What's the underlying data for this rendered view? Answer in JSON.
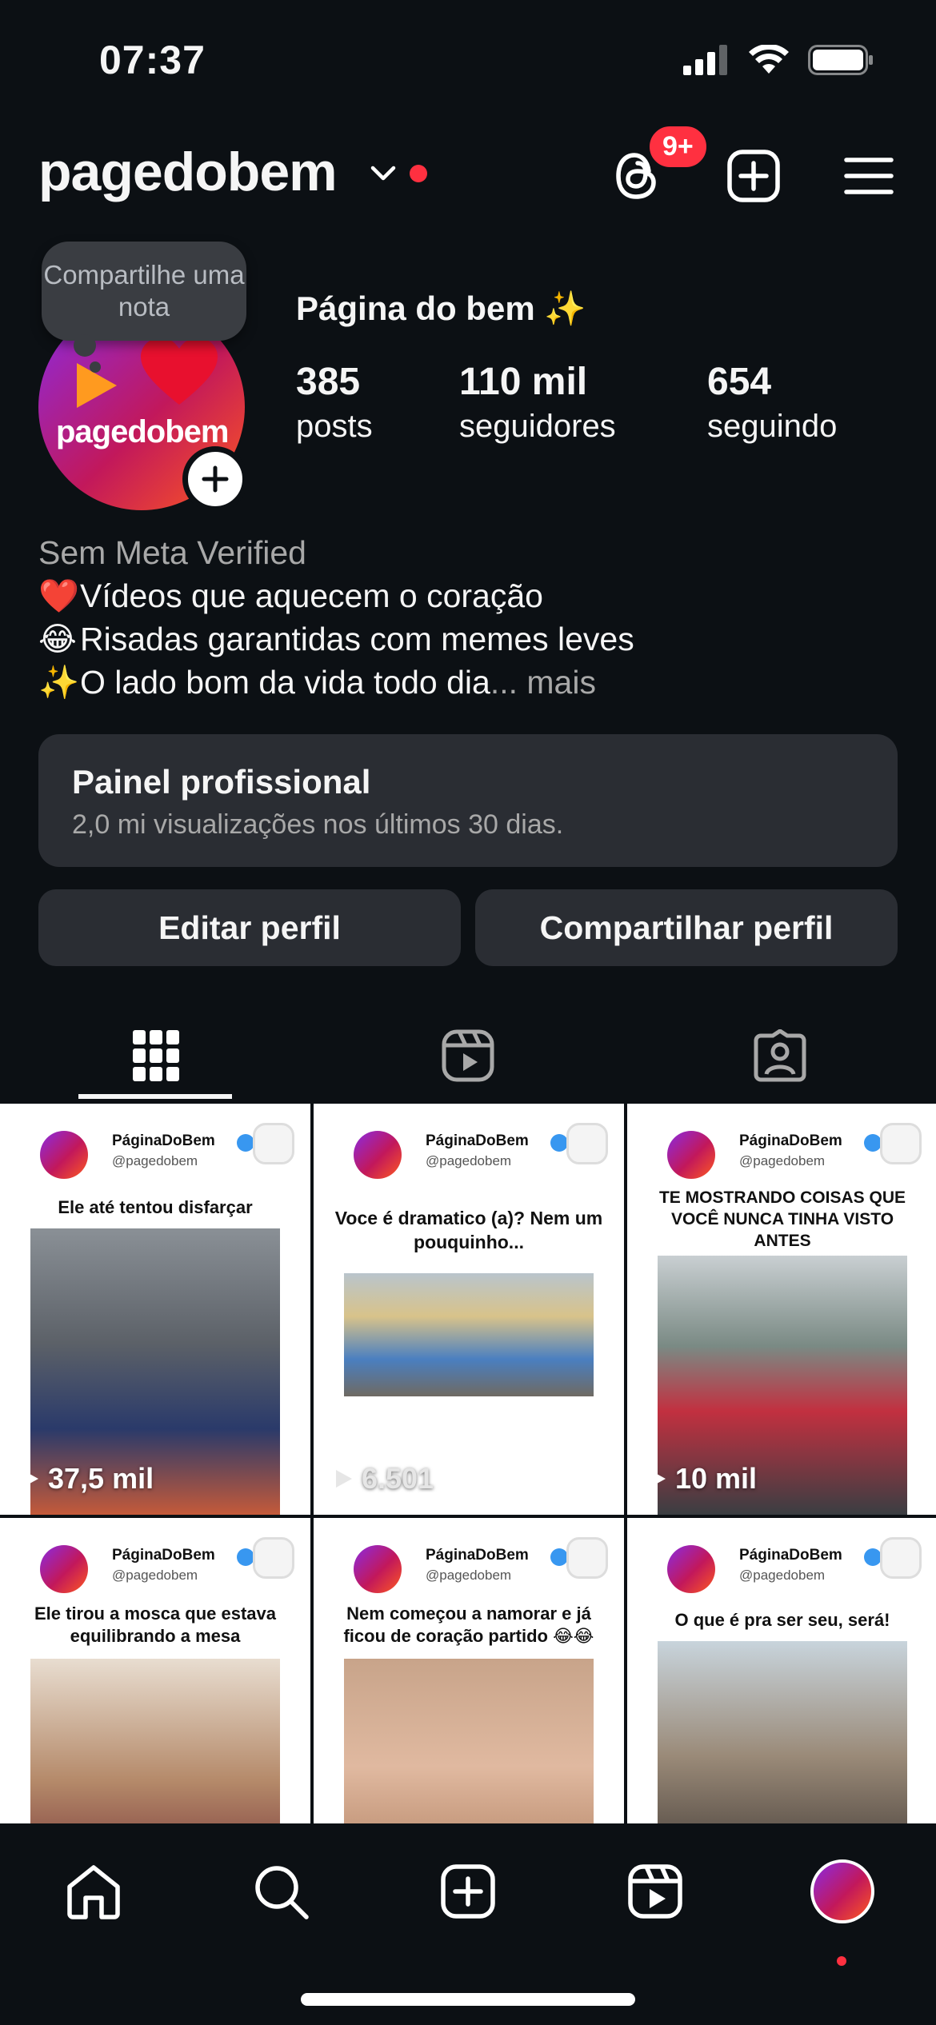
{
  "status_bar": {
    "time": "07:37"
  },
  "header": {
    "username": "pagedobem",
    "threads_badge": "9+"
  },
  "profile": {
    "note_text": "Compartilhe uma nota",
    "avatar_text": "pagedobem",
    "display_name": "Página do bem ✨",
    "stats": [
      {
        "number": "385",
        "label": "posts"
      },
      {
        "number": "110 mil",
        "label": "seguidores"
      },
      {
        "number": "654",
        "label": "seguindo"
      }
    ],
    "bio_category": "Sem Meta Verified",
    "bio_lines": [
      {
        "emoji": "❤️",
        "text": "Vídeos que aquecem o coração"
      },
      {
        "emoji": "😂",
        "text": "Risadas garantidas com memes leves"
      },
      {
        "emoji": "✨",
        "text": "O lado bom da vida todo dia"
      }
    ],
    "bio_more": "... mais"
  },
  "professional_panel": {
    "title": "Painel profissional",
    "subtitle": "2,0 mi visualizações nos últimos 30 dias."
  },
  "buttons": {
    "edit_profile": "Editar perfil",
    "share_profile": "Compartilhar perfil"
  },
  "grid_posts": [
    {
      "name": "PáginaDoBem",
      "handle": "@pagedobem",
      "caption": "Ele até tentou disfarçar",
      "views": "37,5 mil"
    },
    {
      "name": "PáginaDoBem",
      "handle": "@pagedobem",
      "caption": "Voce é dramatico (a)? Nem um pouquinho...",
      "views": "6.501"
    },
    {
      "name": "PáginaDoBem",
      "handle": "@pagedobem",
      "caption": "TE MOSTRANDO COISAS QUE VOCÊ NUNCA TINHA VISTO ANTES",
      "views": "10 mil"
    },
    {
      "name": "PáginaDoBem",
      "handle": "@pagedobem",
      "caption": "Ele tirou a mosca que estava equilibrando a mesa",
      "views": ""
    },
    {
      "name": "PáginaDoBem",
      "handle": "@pagedobem",
      "caption": "Nem começou a namorar e já ficou de coração partido 😂😂",
      "views": ""
    },
    {
      "name": "PáginaDoBem",
      "handle": "@pagedobem",
      "caption": "O que é pra ser seu, será!",
      "views": ""
    }
  ],
  "colors": {
    "background": "#0c1014",
    "surface": "#2a2d33",
    "badge_red": "#ff3040",
    "verified_blue": "#3897f0"
  },
  "icons": {
    "header": [
      "threads-icon",
      "create-plus-icon",
      "menu-icon"
    ],
    "tabs": [
      "grid-icon",
      "reels-icon",
      "tagged-icon"
    ],
    "nav": [
      "home-icon",
      "search-icon",
      "create-icon",
      "reels-icon",
      "profile-avatar"
    ]
  }
}
